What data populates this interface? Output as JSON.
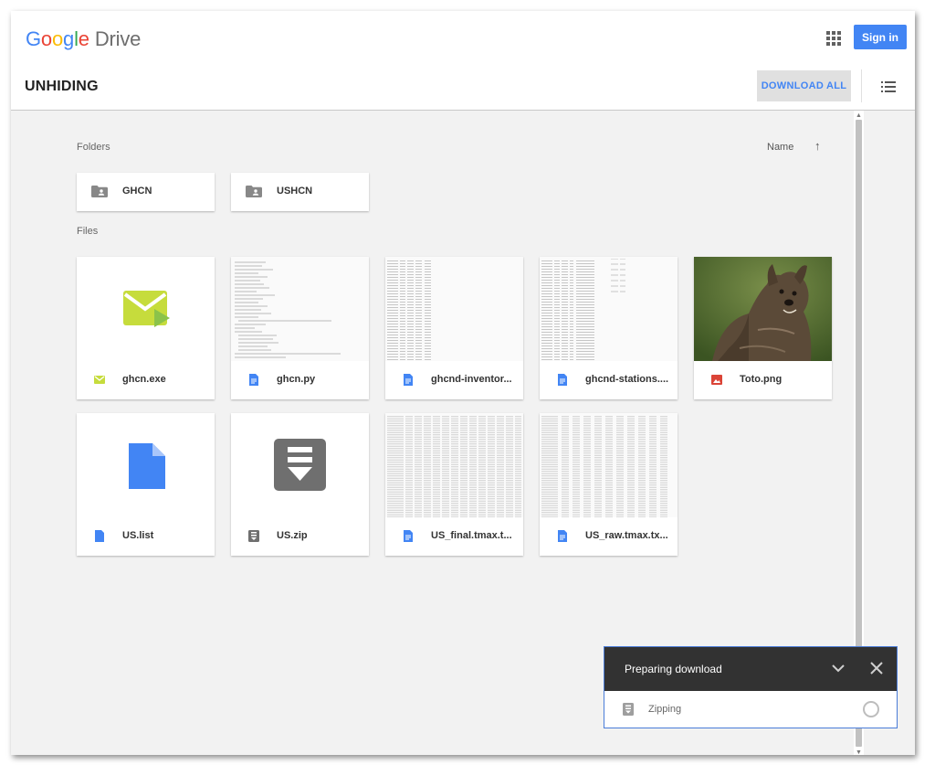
{
  "header": {
    "logo_google": [
      "G",
      "o",
      "o",
      "g",
      "l",
      "e"
    ],
    "logo_drive": "Drive",
    "sign_in_label": "Sign in",
    "folder_title": "UNHIDING",
    "download_all_label": "DOWNLOAD ALL"
  },
  "content": {
    "folders_label": "Folders",
    "files_label": "Files",
    "sort_label": "Name",
    "sort_direction_icon": "arrow-up-icon",
    "folders": [
      {
        "name": "GHCN",
        "icon": "shared-folder-icon"
      },
      {
        "name": "USHCN",
        "icon": "shared-folder-icon"
      }
    ],
    "files": [
      {
        "name": "ghcn.exe",
        "icon": "exe-icon",
        "thumb": "exe"
      },
      {
        "name": "ghcn.py",
        "icon": "doc-icon",
        "thumb": "text"
      },
      {
        "name": "ghcnd-inventor...",
        "icon": "doc-icon",
        "thumb": "text"
      },
      {
        "name": "ghcnd-stations....",
        "icon": "doc-icon",
        "thumb": "text"
      },
      {
        "name": "Toto.png",
        "icon": "image-icon",
        "thumb": "photo"
      },
      {
        "name": "US.list",
        "icon": "doc-icon",
        "thumb": "doc"
      },
      {
        "name": "US.zip",
        "icon": "zip-icon",
        "thumb": "zip"
      },
      {
        "name": "US_final.tmax.t...",
        "icon": "doc-icon",
        "thumb": "text"
      },
      {
        "name": "US_raw.tmax.tx...",
        "icon": "doc-icon",
        "thumb": "text"
      }
    ]
  },
  "download_panel": {
    "title": "Preparing download",
    "status": "Zipping",
    "icons": [
      "chevron-down-icon",
      "close-icon",
      "zip-icon",
      "spinner-icon"
    ]
  },
  "colors": {
    "accent": "#4285f4",
    "exe_green": "#c6dc3c",
    "image_red": "#db4437",
    "panel_dark": "#323232"
  }
}
